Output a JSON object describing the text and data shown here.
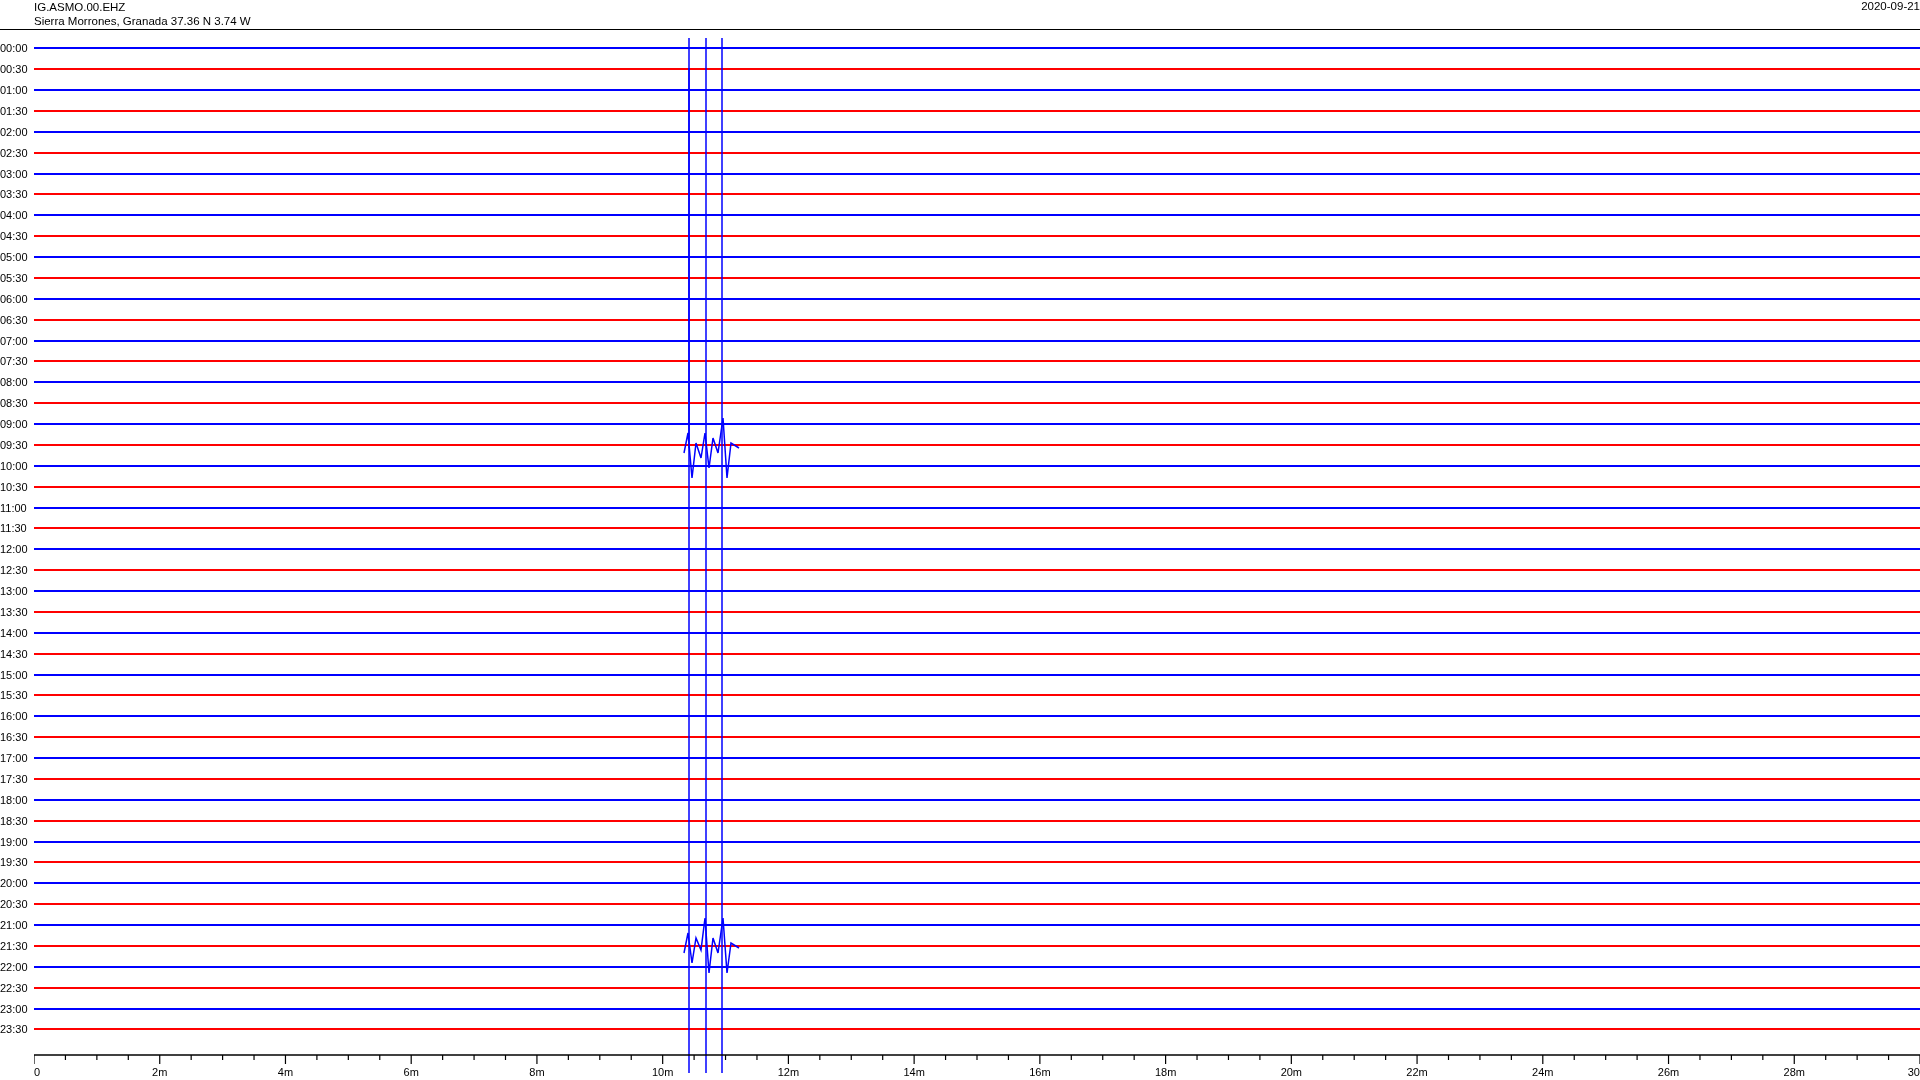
{
  "header": {
    "station": "IG.ASMO.00.EHZ",
    "location": "Sierra Morrones, Granada  37.36 N 3.74 W",
    "date": "2020-09-21"
  },
  "rows": [
    {
      "time": "00:00",
      "color": "#0000ff"
    },
    {
      "time": "00:30",
      "color": "#ff0000"
    },
    {
      "time": "01:00",
      "color": "#0000ff"
    },
    {
      "time": "01:30",
      "color": "#ff0000"
    },
    {
      "time": "02:00",
      "color": "#0000ff"
    },
    {
      "time": "02:30",
      "color": "#ff0000"
    },
    {
      "time": "03:00",
      "color": "#0000ff"
    },
    {
      "time": "03:30",
      "color": "#ff0000"
    },
    {
      "time": "04:00",
      "color": "#0000ff"
    },
    {
      "time": "04:30",
      "color": "#ff0000"
    },
    {
      "time": "05:00",
      "color": "#0000ff"
    },
    {
      "time": "05:30",
      "color": "#ff0000"
    },
    {
      "time": "06:00",
      "color": "#0000ff"
    },
    {
      "time": "06:30",
      "color": "#ff0000"
    },
    {
      "time": "07:00",
      "color": "#0000ff"
    },
    {
      "time": "07:30",
      "color": "#ff0000"
    },
    {
      "time": "08:00",
      "color": "#0000ff"
    },
    {
      "time": "08:30",
      "color": "#ff0000"
    },
    {
      "time": "09:00",
      "color": "#0000ff"
    },
    {
      "time": "09:30",
      "color": "#ff0000"
    },
    {
      "time": "10:00",
      "color": "#0000ff"
    },
    {
      "time": "10:30",
      "color": "#ff0000"
    },
    {
      "time": "11:00",
      "color": "#0000ff"
    },
    {
      "time": "11:30",
      "color": "#ff0000"
    },
    {
      "time": "12:00",
      "color": "#0000ff"
    },
    {
      "time": "12:30",
      "color": "#ff0000"
    },
    {
      "time": "13:00",
      "color": "#0000ff"
    },
    {
      "time": "13:30",
      "color": "#ff0000"
    },
    {
      "time": "14:00",
      "color": "#0000ff"
    },
    {
      "time": "14:30",
      "color": "#ff0000"
    },
    {
      "time": "15:00",
      "color": "#0000ff"
    },
    {
      "time": "15:30",
      "color": "#ff0000"
    },
    {
      "time": "16:00",
      "color": "#0000ff"
    },
    {
      "time": "16:30",
      "color": "#ff0000"
    },
    {
      "time": "17:00",
      "color": "#0000ff"
    },
    {
      "time": "17:30",
      "color": "#ff0000"
    },
    {
      "time": "18:00",
      "color": "#0000ff"
    },
    {
      "time": "18:30",
      "color": "#ff0000"
    },
    {
      "time": "19:00",
      "color": "#0000ff"
    },
    {
      "time": "19:30",
      "color": "#ff0000"
    },
    {
      "time": "20:00",
      "color": "#0000ff"
    },
    {
      "time": "20:30",
      "color": "#ff0000"
    },
    {
      "time": "21:00",
      "color": "#0000ff"
    },
    {
      "time": "21:30",
      "color": "#ff0000"
    },
    {
      "time": "22:00",
      "color": "#0000ff"
    },
    {
      "time": "22:30",
      "color": "#ff0000"
    },
    {
      "time": "23:00",
      "color": "#0000ff"
    },
    {
      "time": "23:30",
      "color": "#ff0000"
    }
  ],
  "x_axis_labels": [
    "0",
    "2m",
    "4m",
    "6m",
    "8m",
    "10m",
    "12m",
    "14m",
    "16m",
    "18m",
    "20m",
    "22m",
    "24m",
    "26m",
    "28m",
    "30"
  ]
}
